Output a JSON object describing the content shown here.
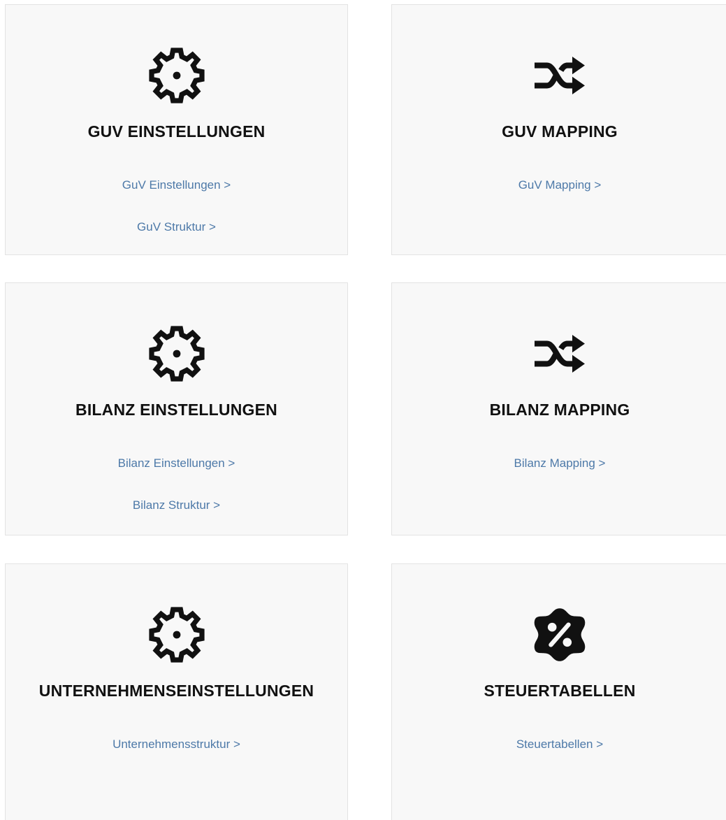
{
  "cards": [
    {
      "icon": "gear-icon",
      "title": "GUV EINSTELLUNGEN",
      "links": [
        "GuV Einstellungen >",
        "GuV Struktur >"
      ]
    },
    {
      "icon": "shuffle-icon",
      "title": "GUV MAPPING",
      "links": [
        "GuV Mapping >"
      ]
    },
    {
      "icon": "gear-icon",
      "title": "BILANZ EINSTELLUNGEN",
      "links": [
        "Bilanz Einstellungen >",
        "Bilanz Struktur >"
      ]
    },
    {
      "icon": "shuffle-icon",
      "title": "BILANZ MAPPING",
      "links": [
        "Bilanz Mapping >"
      ]
    },
    {
      "icon": "gear-icon",
      "title": "UNTERNEHMENSEINSTELLUNGEN",
      "links": [
        "Unternehmensstruktur >"
      ]
    },
    {
      "icon": "percent-badge-icon",
      "title": "STEUERTABELLEN",
      "links": [
        "Steuertabellen >"
      ]
    }
  ],
  "colors": {
    "card_bg": "#f8f8f8",
    "card_border": "#e3e3e3",
    "title": "#111111",
    "link": "#4d79a8",
    "icon": "#111111"
  }
}
